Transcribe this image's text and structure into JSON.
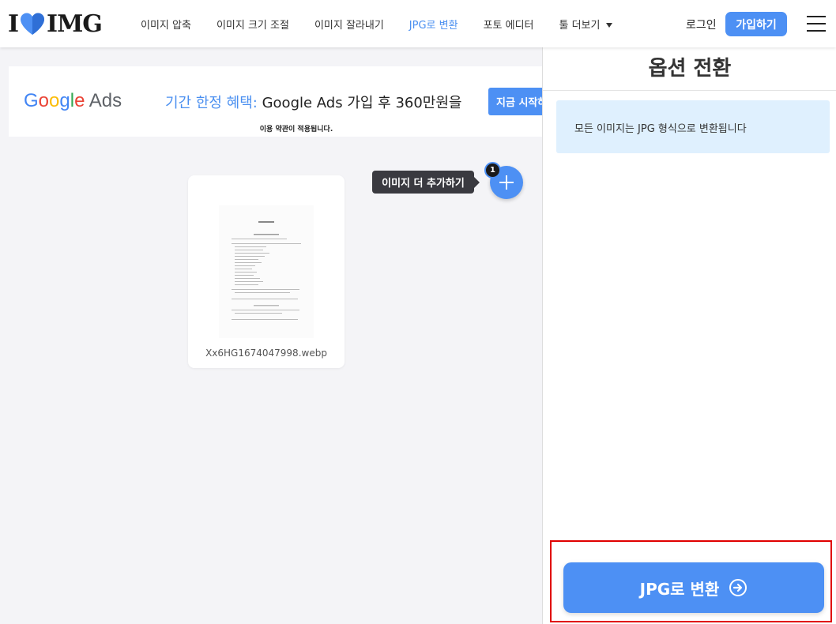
{
  "header": {
    "logo_left": "I",
    "logo_right": "IMG",
    "nav": [
      {
        "label": "이미지 압축"
      },
      {
        "label": "이미지 크기 조절"
      },
      {
        "label": "이미지 잘라내기"
      },
      {
        "label": "JPG로 변환"
      },
      {
        "label": "포토 에디터"
      },
      {
        "label": "툴 더보기"
      }
    ],
    "login": "로그인",
    "signup": "가입하기"
  },
  "ad": {
    "logo": "Google Ads",
    "headline_highlight": "기간 한정 혜택:",
    "headline_rest": " Google Ads 가입 후 360만원을",
    "cta": "지금 시작하",
    "note": "이용 약관이 적용됩니다."
  },
  "workspace": {
    "tooltip": "이미지 더 추가하기",
    "file_count": "1",
    "file_name": "Xx6HG1674047998.webp"
  },
  "sidebar": {
    "title": "옵션 전환",
    "info": "모든 이미지는 JPG 형식으로 변환됩니다",
    "convert_button": "JPG로 변환"
  },
  "colors": {
    "accent": "#4d90f4",
    "active_nav": "#4a8ff0",
    "info_bg": "#dff0fe",
    "highlight_border": "#e00000"
  },
  "icons": {
    "logo_heart": "heart-icon",
    "dropdown": "caret-down-icon",
    "menu": "hamburger-icon",
    "add": "plus-icon",
    "convert": "arrow-right-circle-icon"
  }
}
